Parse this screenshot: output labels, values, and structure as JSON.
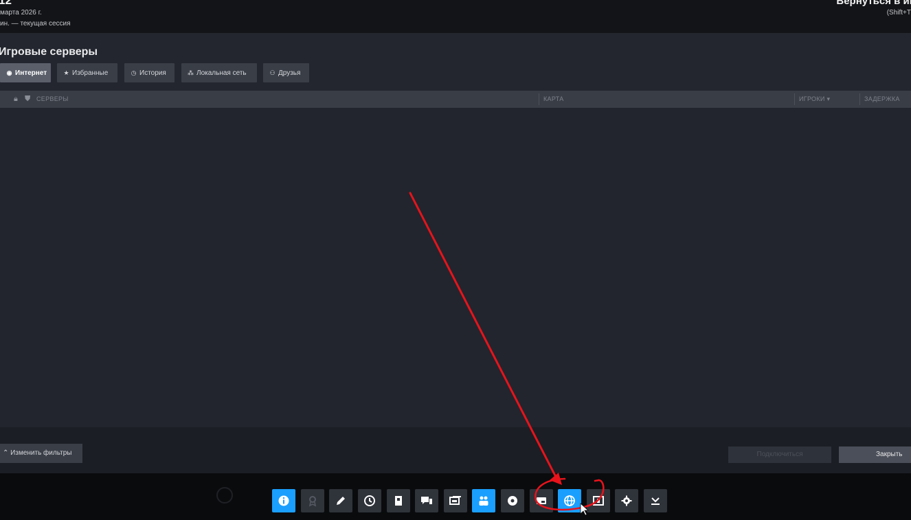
{
  "overlay": {
    "left_number": "12",
    "date": "марта 2026 г.",
    "session": "ин. — текущая сессия",
    "return_label": "Вернуться в иг",
    "return_shortcut": "(Shift+T"
  },
  "servers": {
    "title": "Игровые серверы",
    "tabs": [
      {
        "label": "Интернет",
        "icon": "globe-icon",
        "active": true
      },
      {
        "label": "Избранные",
        "icon": "star-icon",
        "active": false
      },
      {
        "label": "История",
        "icon": "clock-icon",
        "active": false
      },
      {
        "label": "Локальная сеть",
        "icon": "network-icon",
        "active": false
      },
      {
        "label": "Друзья",
        "icon": "friends-icon",
        "active": false
      }
    ],
    "columns": {
      "servers": "СЕРВЕРЫ",
      "map": "КАРТА",
      "players": "ИГРОКИ ▾",
      "latency": "ЗАДЕРЖКА"
    },
    "change_filters": "Изменить фильтры",
    "connect": "Подключиться",
    "close": "Закрыть"
  },
  "taskbar": {
    "buttons": [
      {
        "icon": "info-icon",
        "active": true
      },
      {
        "icon": "achievements-icon",
        "active": false
      },
      {
        "icon": "pencil-icon",
        "active": false
      },
      {
        "icon": "clock-icon",
        "active": false
      },
      {
        "icon": "guide-icon",
        "active": false
      },
      {
        "icon": "chat-icon",
        "active": false
      },
      {
        "icon": "screenshots-icon",
        "active": false
      },
      {
        "icon": "friends-icon",
        "active": true
      },
      {
        "icon": "music-icon",
        "active": false
      },
      {
        "icon": "browser-icon",
        "active": false
      },
      {
        "icon": "globe-icon",
        "active": true
      },
      {
        "icon": "recording-icon",
        "active": false
      },
      {
        "icon": "settings-icon",
        "active": false
      },
      {
        "icon": "download-icon",
        "active": false
      }
    ]
  },
  "colors": {
    "accent": "#1a9fff",
    "annotation": "#e8131b",
    "window_bg": "#23262e",
    "header_bg": "#393d46"
  }
}
